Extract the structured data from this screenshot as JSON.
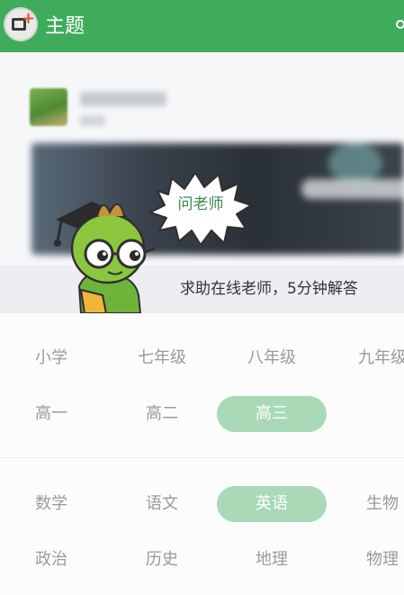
{
  "app_bar": {
    "title": "主题"
  },
  "promo": {
    "text": "求助在线老师，5分钟解答"
  },
  "bubble": {
    "text": "问老师"
  },
  "grades": [
    {
      "label": "小学",
      "selected": false
    },
    {
      "label": "七年级",
      "selected": false
    },
    {
      "label": "八年级",
      "selected": false
    },
    {
      "label": "九年级",
      "selected": false
    },
    {
      "label": "高一",
      "selected": false
    },
    {
      "label": "高二",
      "selected": false
    },
    {
      "label": "高三",
      "selected": true
    }
  ],
  "subjects": [
    {
      "label": "数学",
      "selected": false
    },
    {
      "label": "语文",
      "selected": false
    },
    {
      "label": "英语",
      "selected": true
    },
    {
      "label": "生物",
      "selected": false
    },
    {
      "label": "政治",
      "selected": false
    },
    {
      "label": "历史",
      "selected": false
    },
    {
      "label": "地理",
      "selected": false
    },
    {
      "label": "物理",
      "selected": false
    }
  ],
  "colors": {
    "brand_green": "#3fac5c",
    "selected_pill": "#a9d9b6",
    "option_text": "#9a9a9a"
  }
}
